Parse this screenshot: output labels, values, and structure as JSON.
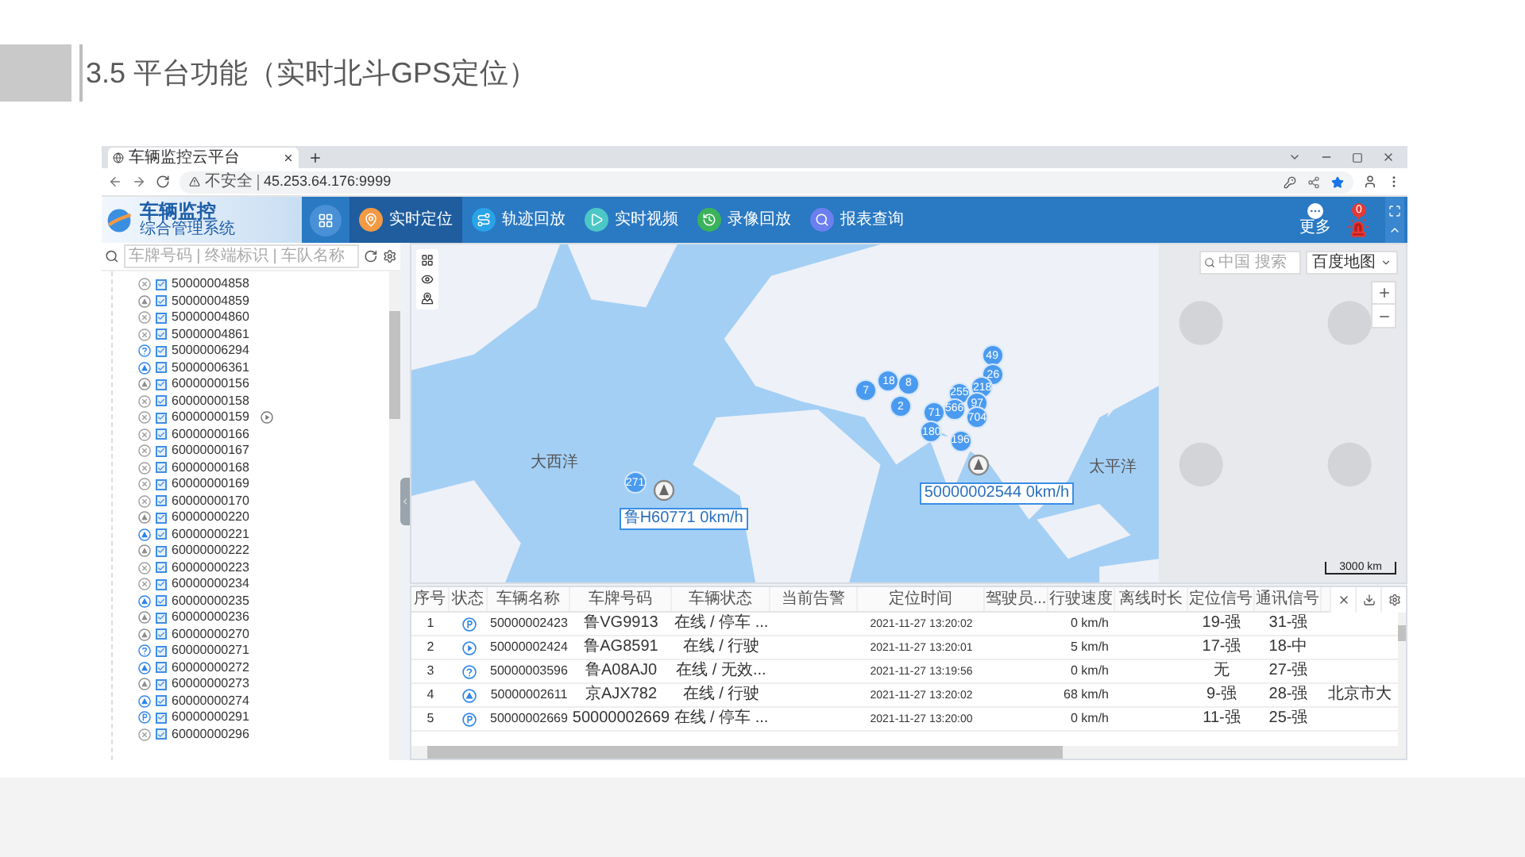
{
  "slide": {
    "title": "3.5 平台功能（实时北斗GPS定位）"
  },
  "browser": {
    "tab_title": "车辆监控云平台",
    "security": "不安全",
    "url": "45.253.64.176:9999"
  },
  "app": {
    "logo_title": "车辆监控",
    "logo_subtitle": "综合管理系统",
    "nav": [
      {
        "label": "实时定位",
        "selected": true,
        "kind": "location"
      },
      {
        "label": "轨迹回放",
        "selected": false,
        "kind": "track"
      },
      {
        "label": "实时视频",
        "selected": false,
        "kind": "video"
      },
      {
        "label": "录像回放",
        "selected": false,
        "kind": "playback"
      },
      {
        "label": "报表查询",
        "selected": false,
        "kind": "report"
      }
    ],
    "more_label": "更多",
    "alarm_count": "0"
  },
  "sidebar": {
    "search_placeholder": "车牌号码 | 终端标识 | 车队名称",
    "vehicles": [
      {
        "id": "50000004858",
        "kind": "offline",
        "checked": true,
        "playback": false
      },
      {
        "id": "50000004859",
        "kind": "idle",
        "checked": true,
        "playback": false
      },
      {
        "id": "50000004860",
        "kind": "offline",
        "checked": true,
        "playback": false
      },
      {
        "id": "50000004861",
        "kind": "offline",
        "checked": true,
        "playback": false
      },
      {
        "id": "50000006294",
        "kind": "unknown",
        "checked": true,
        "playback": false
      },
      {
        "id": "50000006361",
        "kind": "moving",
        "checked": true,
        "playback": false
      },
      {
        "id": "60000000156",
        "kind": "idle",
        "checked": true,
        "playback": false
      },
      {
        "id": "60000000158",
        "kind": "offline",
        "checked": true,
        "playback": false
      },
      {
        "id": "60000000159",
        "kind": "offline",
        "checked": true,
        "playback": true
      },
      {
        "id": "60000000166",
        "kind": "offline",
        "checked": true,
        "playback": false
      },
      {
        "id": "60000000167",
        "kind": "offline",
        "checked": true,
        "playback": false
      },
      {
        "id": "60000000168",
        "kind": "offline",
        "checked": true,
        "playback": false
      },
      {
        "id": "60000000169",
        "kind": "offline",
        "checked": true,
        "playback": false
      },
      {
        "id": "60000000170",
        "kind": "offline",
        "checked": true,
        "playback": false
      },
      {
        "id": "60000000220",
        "kind": "idle",
        "checked": true,
        "playback": false
      },
      {
        "id": "60000000221",
        "kind": "moving",
        "checked": true,
        "playback": false
      },
      {
        "id": "60000000222",
        "kind": "idle",
        "checked": true,
        "playback": false
      },
      {
        "id": "60000000223",
        "kind": "offline",
        "checked": true,
        "playback": false
      },
      {
        "id": "60000000234",
        "kind": "offline",
        "checked": true,
        "playback": false
      },
      {
        "id": "60000000235",
        "kind": "moving",
        "checked": true,
        "playback": false
      },
      {
        "id": "60000000236",
        "kind": "idle",
        "checked": true,
        "playback": false
      },
      {
        "id": "60000000270",
        "kind": "idle",
        "checked": true,
        "playback": false
      },
      {
        "id": "60000000271",
        "kind": "unknown",
        "checked": true,
        "playback": false
      },
      {
        "id": "60000000272",
        "kind": "moving",
        "checked": true,
        "playback": false
      },
      {
        "id": "60000000273",
        "kind": "idle",
        "checked": true,
        "playback": false
      },
      {
        "id": "60000000274",
        "kind": "moving",
        "checked": true,
        "playback": false
      },
      {
        "id": "60000000291",
        "kind": "parking",
        "checked": true,
        "playback": false
      },
      {
        "id": "60000000296",
        "kind": "offline",
        "checked": true,
        "playback": false
      }
    ]
  },
  "map": {
    "search_placeholder": "中国 搜索",
    "layer": "百度地图",
    "scale": "3000 km",
    "labels": [
      "大西洋",
      "太平洋"
    ],
    "clusters": [
      "49",
      "26",
      "18",
      "8",
      "7",
      "218",
      "255",
      "2",
      "97",
      "566",
      "71",
      "704",
      "180",
      "196",
      "271"
    ],
    "callouts": [
      "50000002544 0km/h",
      "鲁H60771 0km/h"
    ]
  },
  "table": {
    "columns": [
      "序号",
      "状态",
      "车辆名称",
      "车牌号码",
      "车辆状态",
      "当前告警",
      "定位时间",
      "驾驶员...",
      "行驶速度",
      "离线时长",
      "定位信号",
      "通讯信号"
    ],
    "rows": [
      {
        "no": "1",
        "kind": "parking",
        "name": "50000002423",
        "plate": "鲁VG9913",
        "state": "在线 / 停车 ...",
        "time": "2021-11-27 13:20:02",
        "speed": "0 km/h",
        "gps_signal": "19-强",
        "net_signal": "31-强"
      },
      {
        "no": "2",
        "kind": "driving",
        "name": "50000002424",
        "plate": "鲁AG8591",
        "state": "在线 / 行驶",
        "time": "2021-11-27 13:20:01",
        "speed": "5 km/h",
        "gps_signal": "17-强",
        "net_signal": "18-中"
      },
      {
        "no": "3",
        "kind": "unknown",
        "name": "50000003596",
        "plate": "鲁A08AJ0",
        "state": "在线 / 无效...",
        "time": "2021-11-27 13:19:56",
        "speed": "0 km/h",
        "gps_signal": "无",
        "net_signal": "27-强"
      },
      {
        "no": "4",
        "kind": "moving",
        "name": "50000002611",
        "plate": "京AJX782",
        "state": "在线 / 行驶",
        "time": "2021-11-27 13:20:02",
        "speed": "68 km/h",
        "gps_signal": "9-强",
        "net_signal": "28-强",
        "address": "北京市大"
      },
      {
        "no": "5",
        "kind": "parking",
        "name": "50000002669",
        "plate": "50000002669",
        "state": "在线 / 停车 ...",
        "time": "2021-11-27 13:20:00",
        "speed": "0 km/h",
        "gps_signal": "11-强",
        "net_signal": "25-强"
      }
    ]
  }
}
